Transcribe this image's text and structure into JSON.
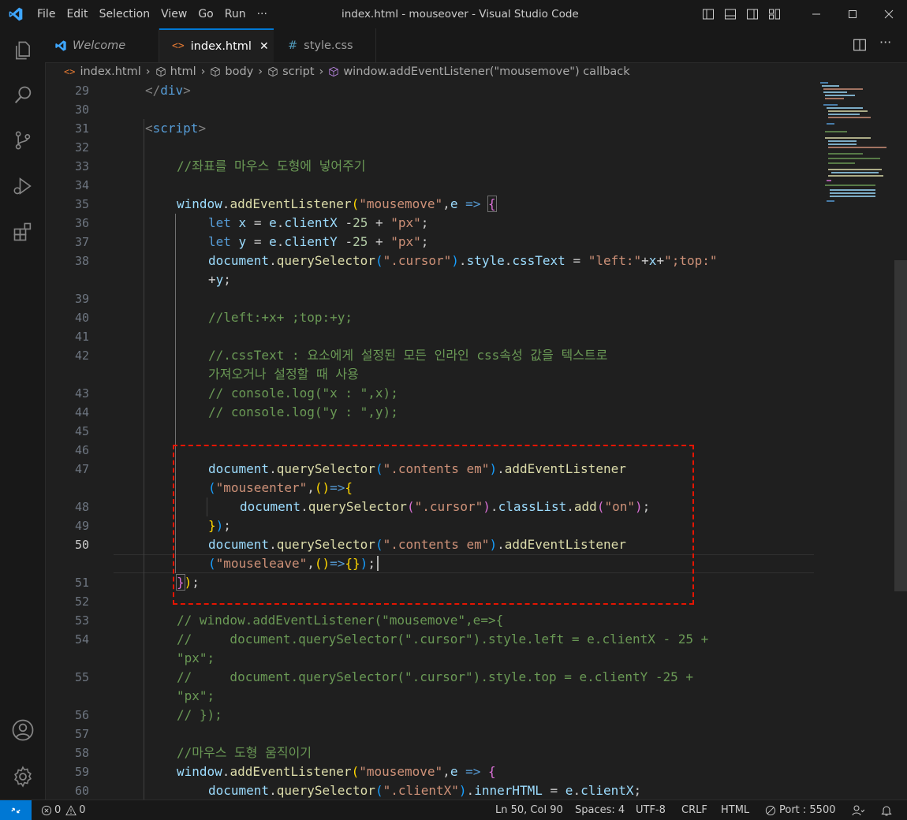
{
  "titlebar": {
    "menu": [
      "File",
      "Edit",
      "Selection",
      "View",
      "Go",
      "Run",
      "···"
    ],
    "title": "index.html - mouseover - Visual Studio Code"
  },
  "tabs": [
    {
      "label": "Welcome",
      "icon": "vscode-icon"
    },
    {
      "label": "index.html",
      "icon": "html-icon",
      "active": true,
      "close": "✕"
    },
    {
      "label": "style.css",
      "icon": "css-hash-icon",
      "hash": "#"
    }
  ],
  "breadcrumb": [
    "index.html",
    "html",
    "body",
    "script",
    "window.addEventListener(\"mousemove\") callback"
  ],
  "editor": {
    "line_numbers": [
      "29",
      "30",
      "31",
      "32",
      "33",
      "34",
      "35",
      "36",
      "37",
      "38",
      "39",
      "40",
      "41",
      "42",
      "43",
      "44",
      "45",
      "46",
      "47",
      "48",
      "49",
      "50",
      "51",
      "52",
      "53",
      "54",
      "55",
      "56",
      "57",
      "58",
      "59",
      "60"
    ],
    "comment_33": "//좌표를 마우스 도형에 넣어주기",
    "comment_40": "//left:+x+ ;top:+y;",
    "comment_42a": "//.cssText : 요소에게 설정된 모든 인라인 css속성 값을 텍스트로",
    "comment_42b": "가져오거나 설정할 때 사용",
    "comment_43": "// console.log(\"x : \",x);",
    "comment_44": "// console.log(\"y : \",y);",
    "comment_53": "// window.addEventListener(\"mousemove\",e=>{",
    "comment_54a": "//     document.querySelector(\".cursor\").style.left = e.clientX - 25 +",
    "comment_54b": "\"px\";",
    "comment_55a": "//     document.querySelector(\".cursor\").style.top = e.clientY -25 +",
    "comment_55b": "\"px\";",
    "comment_56": "// });",
    "comment_58": "//마우스 도형 움직이기"
  },
  "statusbar": {
    "errors": "0",
    "warnings": "0",
    "position": "Ln 50, Col 90",
    "spaces": "Spaces: 4",
    "encoding": "UTF-8",
    "eol": "CRLF",
    "language": "HTML",
    "port": "Port : 5500"
  },
  "colors": {
    "accent": "#0078d4",
    "highlight_box": "#e51400"
  }
}
